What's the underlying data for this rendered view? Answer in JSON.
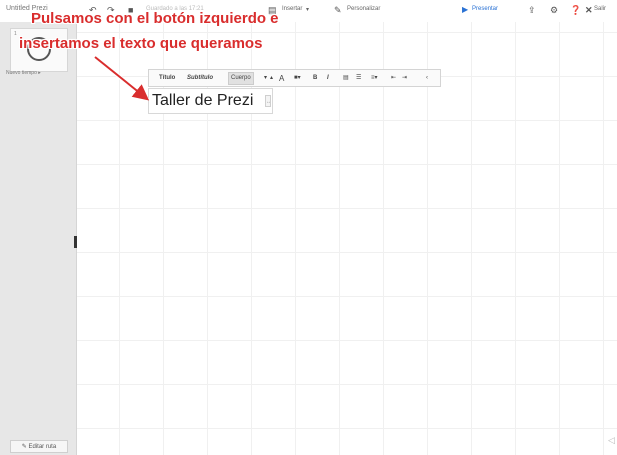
{
  "topbar": {
    "title": "Untitled Prezi",
    "save_status": "Guardado a las 17:21",
    "insert_label": "Insertar",
    "customize_label": "Personalizar",
    "present_label": "Presentar",
    "exit_label": "Salir"
  },
  "sidebar": {
    "thumb_number": "1",
    "path_add": "Nuevo tiempo ▸",
    "edit_path": "Editar ruta"
  },
  "text_toolbar": {
    "title_style": "Título",
    "subtitle_style": "Subtítulo",
    "body_style": "Cuerpo",
    "font_size_label": "A",
    "bold": "B",
    "italic": "I"
  },
  "textbox": {
    "text": "Taller de Prezi"
  },
  "annotation": {
    "line1": "Pulsamos con el botón izquierdo e",
    "line2": "insertamos el texto que queramos",
    "color": "#d92d2d"
  },
  "colors": {
    "accent": "#2a72d4",
    "sidebar": "#e7e7e7"
  }
}
